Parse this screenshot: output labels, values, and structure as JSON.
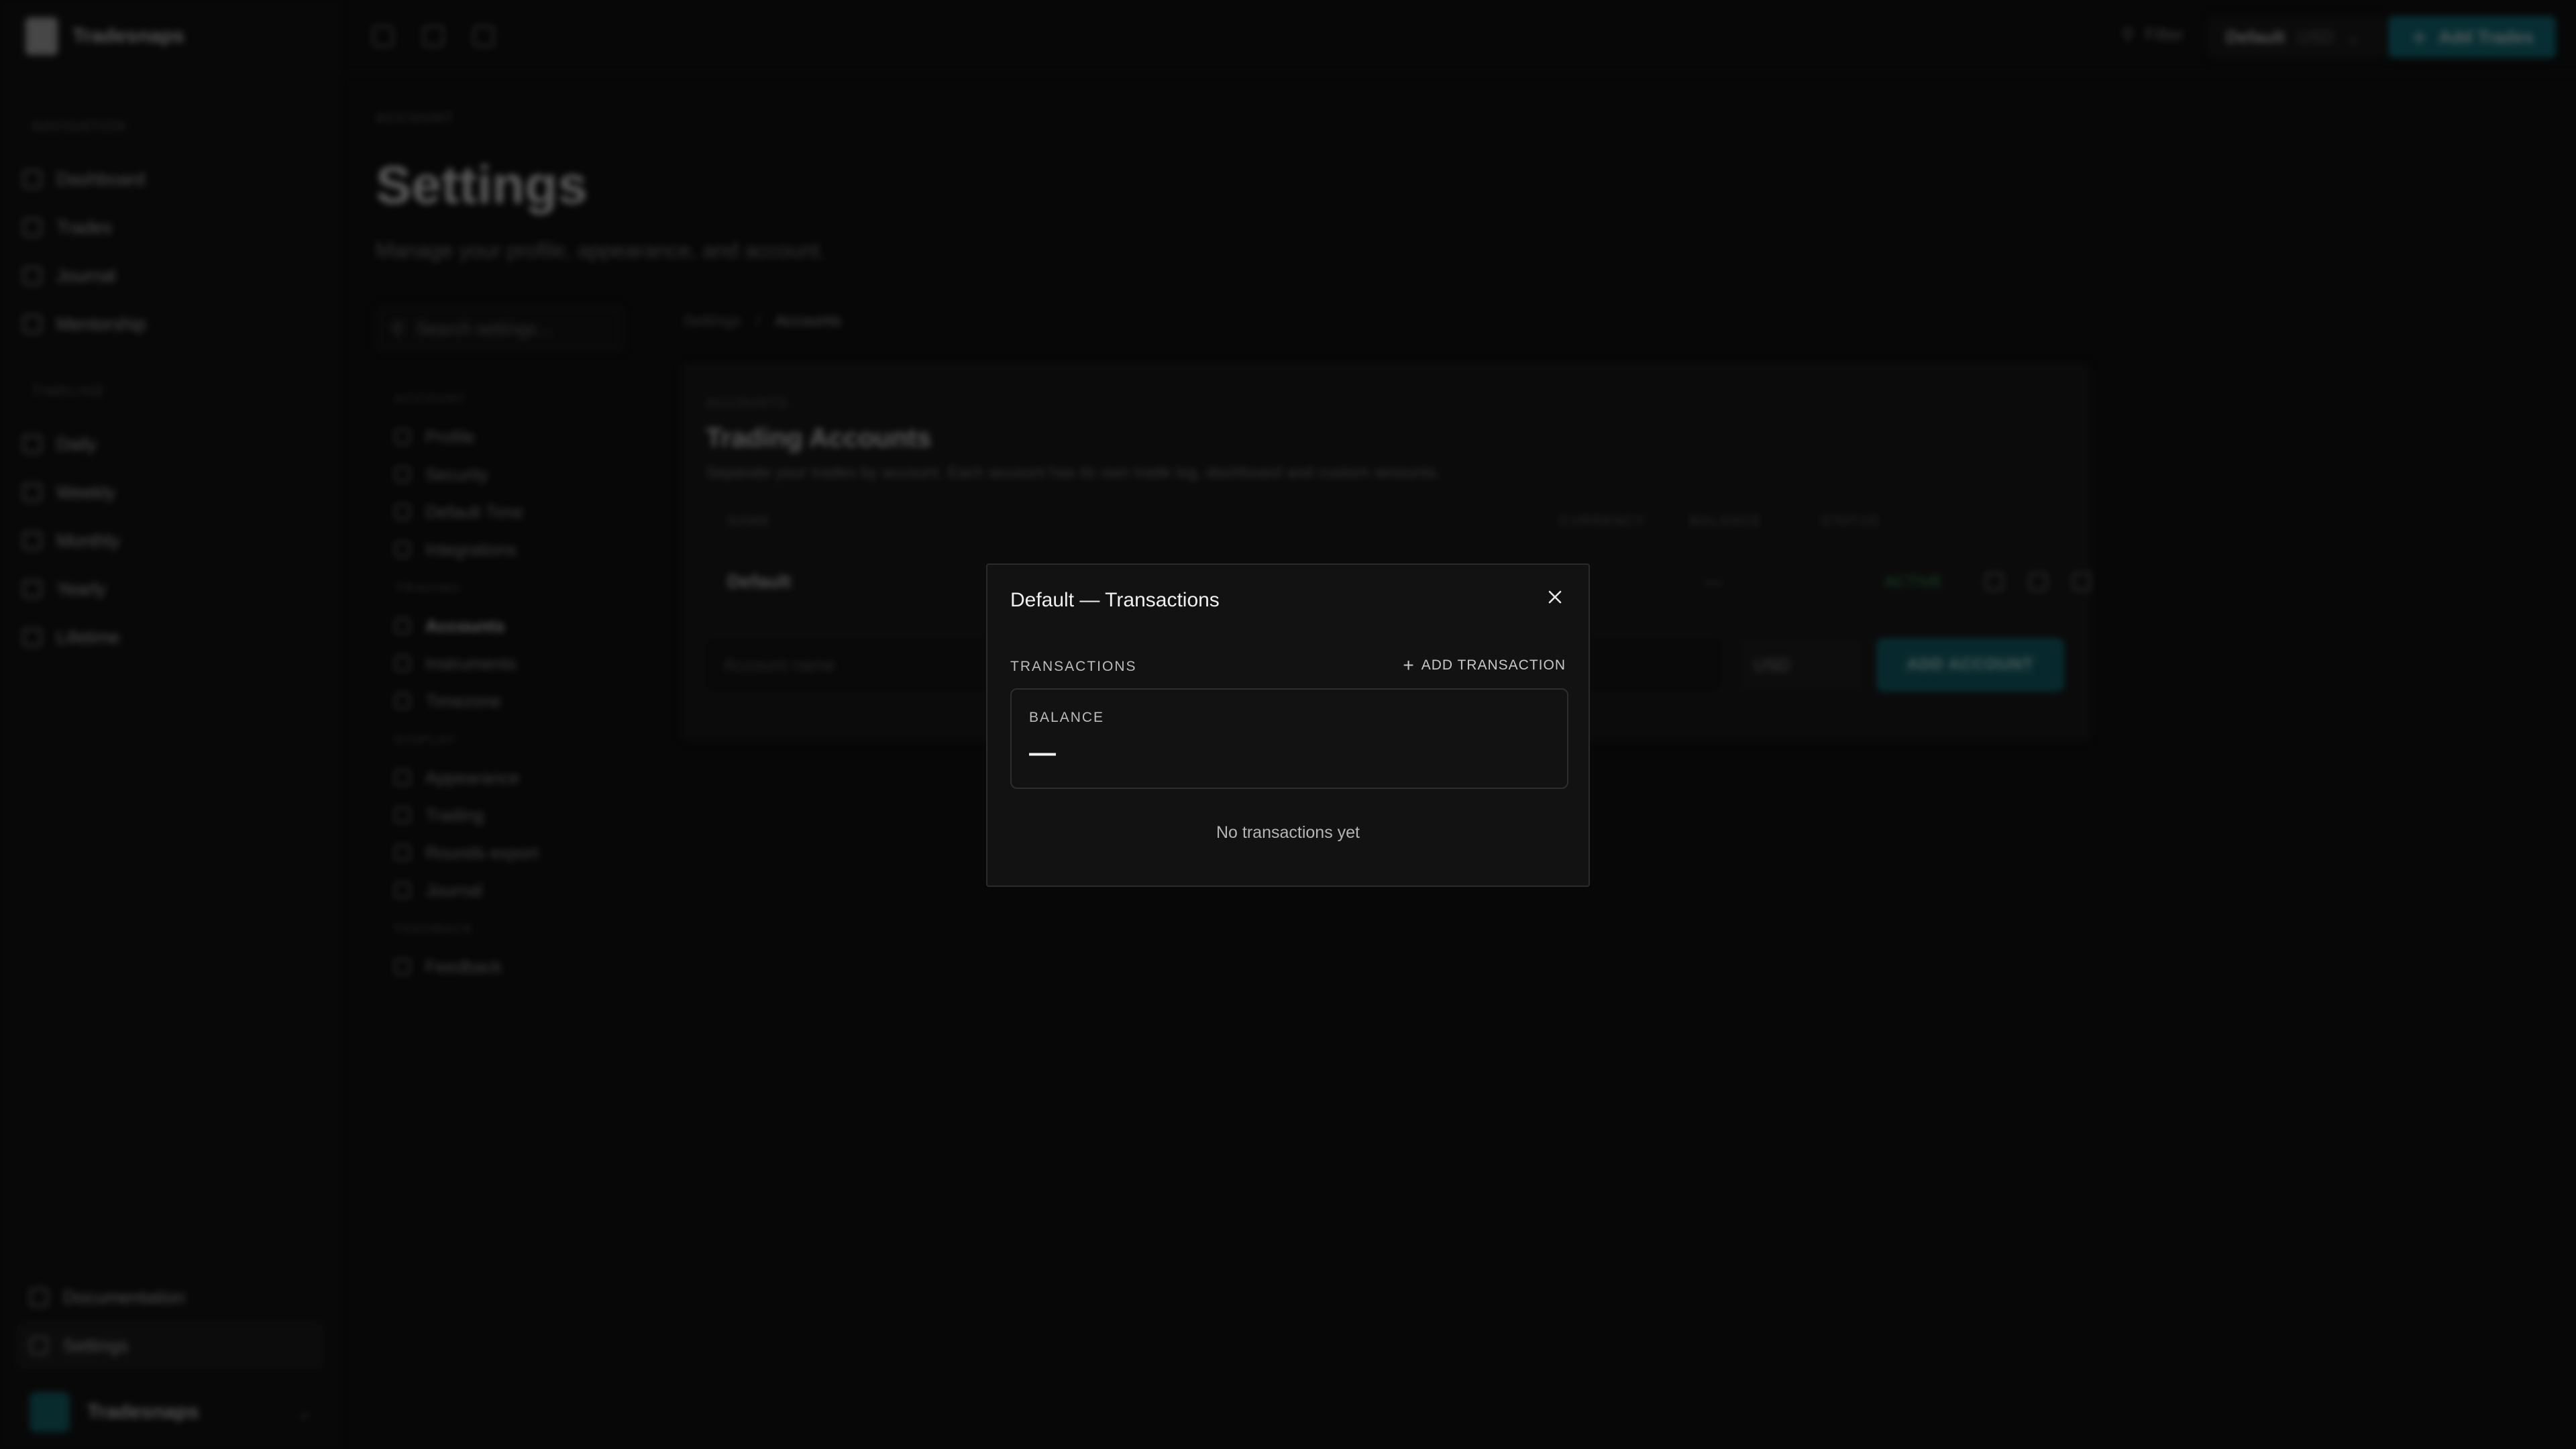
{
  "sidebar": {
    "brand": "Tradesnaps",
    "sections": [
      {
        "heading": "NAVIGATION",
        "items": [
          "Dashboard",
          "Trades",
          "Journal",
          "Mentorship"
        ]
      },
      {
        "heading": "TIMELINE",
        "items": [
          "Daily",
          "Weekly",
          "Monthly",
          "Yearly",
          "Lifetime"
        ]
      }
    ],
    "bottom": {
      "documentation": "Documentation",
      "settings": "Settings",
      "user": "Tradesnaps"
    }
  },
  "topbar": {
    "filter": "Filter",
    "account_name": "Default",
    "account_currency": "USD",
    "add_trades": "Add Trades"
  },
  "page": {
    "eyebrow": "ACCOUNT",
    "title": "Settings",
    "subtitle": "Manage your profile, appearance, and account.",
    "search_placeholder": "Search settings..."
  },
  "settings_nav": [
    {
      "heading": "ACCOUNT",
      "items": [
        "Profile",
        "Security",
        "Default Time",
        "Integrations"
      ]
    },
    {
      "heading": "TRADING",
      "items": [
        "Accounts",
        "Instruments",
        "Timezone"
      ]
    },
    {
      "heading": "DISPLAY",
      "items": [
        "Appearance",
        "Trading",
        "Rounds export",
        "Journal"
      ]
    },
    {
      "heading": "FEEDBACK",
      "items": [
        "Feedback"
      ]
    }
  ],
  "breadcrumb": {
    "root": "Settings",
    "sep": "/",
    "current": "Accounts"
  },
  "card": {
    "eyebrow": "ACCOUNTS",
    "title": "Trading Accounts",
    "description": "Separate your trades by account. Each account has its own trade log, dashboard and custom amounts.",
    "columns": {
      "name": "NAME",
      "currency": "CURRENCY",
      "balance": "BALANCE",
      "status": "STATUS"
    },
    "row": {
      "name": "Default",
      "balance": "—",
      "status": "ACTIVE"
    },
    "input_placeholder": "Account name",
    "currency": "USD",
    "add_button": "ADD ACCOUNT"
  },
  "modal": {
    "title": "Default — Transactions",
    "section_label": "TRANSACTIONS",
    "add_label": "ADD TRANSACTION",
    "balance_label": "BALANCE",
    "balance_value": "—",
    "empty": "No transactions yet"
  }
}
